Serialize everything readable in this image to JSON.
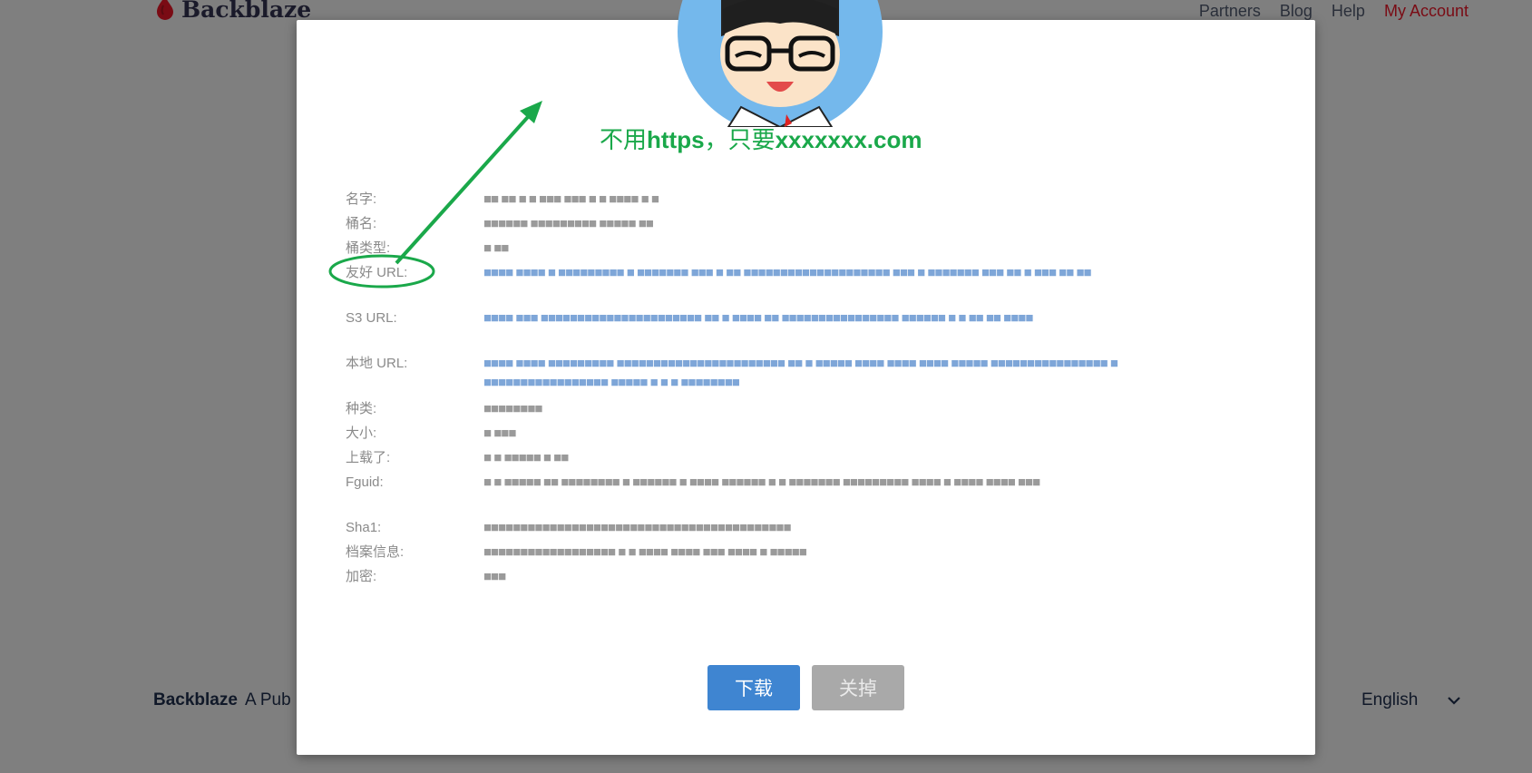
{
  "header": {
    "brand": "Backblaze",
    "nav": [
      "Partners",
      "Blog",
      "Help"
    ],
    "account": "My Account"
  },
  "footer": {
    "brand": "Backblaze",
    "tagline": "A Pub",
    "language": "English"
  },
  "modal": {
    "annotation_cn1": "不用",
    "annotation_en1": "https",
    "annotation_cn2": "，只要",
    "annotation_en2": "xxxxxxx.com",
    "fields": {
      "name": {
        "label": "名字:",
        "value": "■■ ■■ ■ ■ ■■■ ■■■ ■ ■ ■■■■ ■ ■"
      },
      "bucket": {
        "label": "桶名:",
        "value": "■■■■■■ ■■■■■■■■■ ■■■■■ ■■"
      },
      "bucket_type": {
        "label": "桶类型:",
        "value": "■ ■■"
      },
      "friendly_url": {
        "label": "友好 URL:",
        "value": "■■■■ ■■■■ ■ ■■■■■■■■■ ■ ■■■■■■■ ■■■ ■ ■■ ■■■■■■■■■■■■■■■■■■■■ ■■■ ■ ■■■■■■■ ■■■ ■■ ■ ■■■ ■■ ■■"
      },
      "s3_url": {
        "label": "S3 URL:",
        "value": "■■■■ ■■■ ■■■■■■■■■■■■■■■■■■■■■■ ■■ ■ ■■■■ ■■ ■■■■■■■■■■■■■■■■ ■■■■■■ ■ ■ ■■ ■■ ■■■■"
      },
      "native_url": {
        "label": "本地 URL:",
        "value": "■■■■ ■■■■ ■■■■■■■■■ ■■■■■■■■■■■■■■■■■■■■■■■ ■■ ■ ■■■■■ ■■■■ ■■■■ ■■■■ ■■■■■ ■■■■■■■■■■■■■■■■ ■■■■■■■■■■■■■■■■■■ ■■■■■ ■ ■ ■ ■■■■■■■■"
      },
      "type": {
        "label": "种类:",
        "value": "■■■■■■■■"
      },
      "size": {
        "label": "大小:",
        "value": "■ ■■■"
      },
      "uploaded": {
        "label": "上载了:",
        "value": "■ ■ ■■■■■ ■ ■■"
      },
      "fguid": {
        "label": "Fguid:",
        "value": "■ ■ ■■■■■ ■■ ■■■■■■■■ ■ ■■■■■■ ■ ■■■■ ■■■■■■ ■ ■ ■■■■■■■ ■■■■■■■■■ ■■■■ ■ ■■■■ ■■■■ ■■■"
      },
      "sha1": {
        "label": "Sha1:",
        "value": "■■■■■■■■■■■■■■■■■■■■■■■■■■■■■■■■■■■■■■■■■■"
      },
      "file_info": {
        "label": "档案信息:",
        "value": "■■■■■■■■■■■■■■■■■■ ■ ■ ■■■■ ■■■■ ■■■ ■■■■ ■ ■■■■■"
      },
      "encryption": {
        "label": "加密:",
        "value": "■■■"
      }
    },
    "download_label": "下载",
    "close_label": "关掉"
  },
  "colors": {
    "accent": "#3f85d1",
    "annotation": "#1aa84a",
    "account_link": "#7a0b14"
  },
  "icons": [
    "backblaze-flame-icon",
    "chevron-down-icon",
    "avatar-image",
    "annotation-arrow-icon",
    "annotation-ellipse-icon"
  ]
}
